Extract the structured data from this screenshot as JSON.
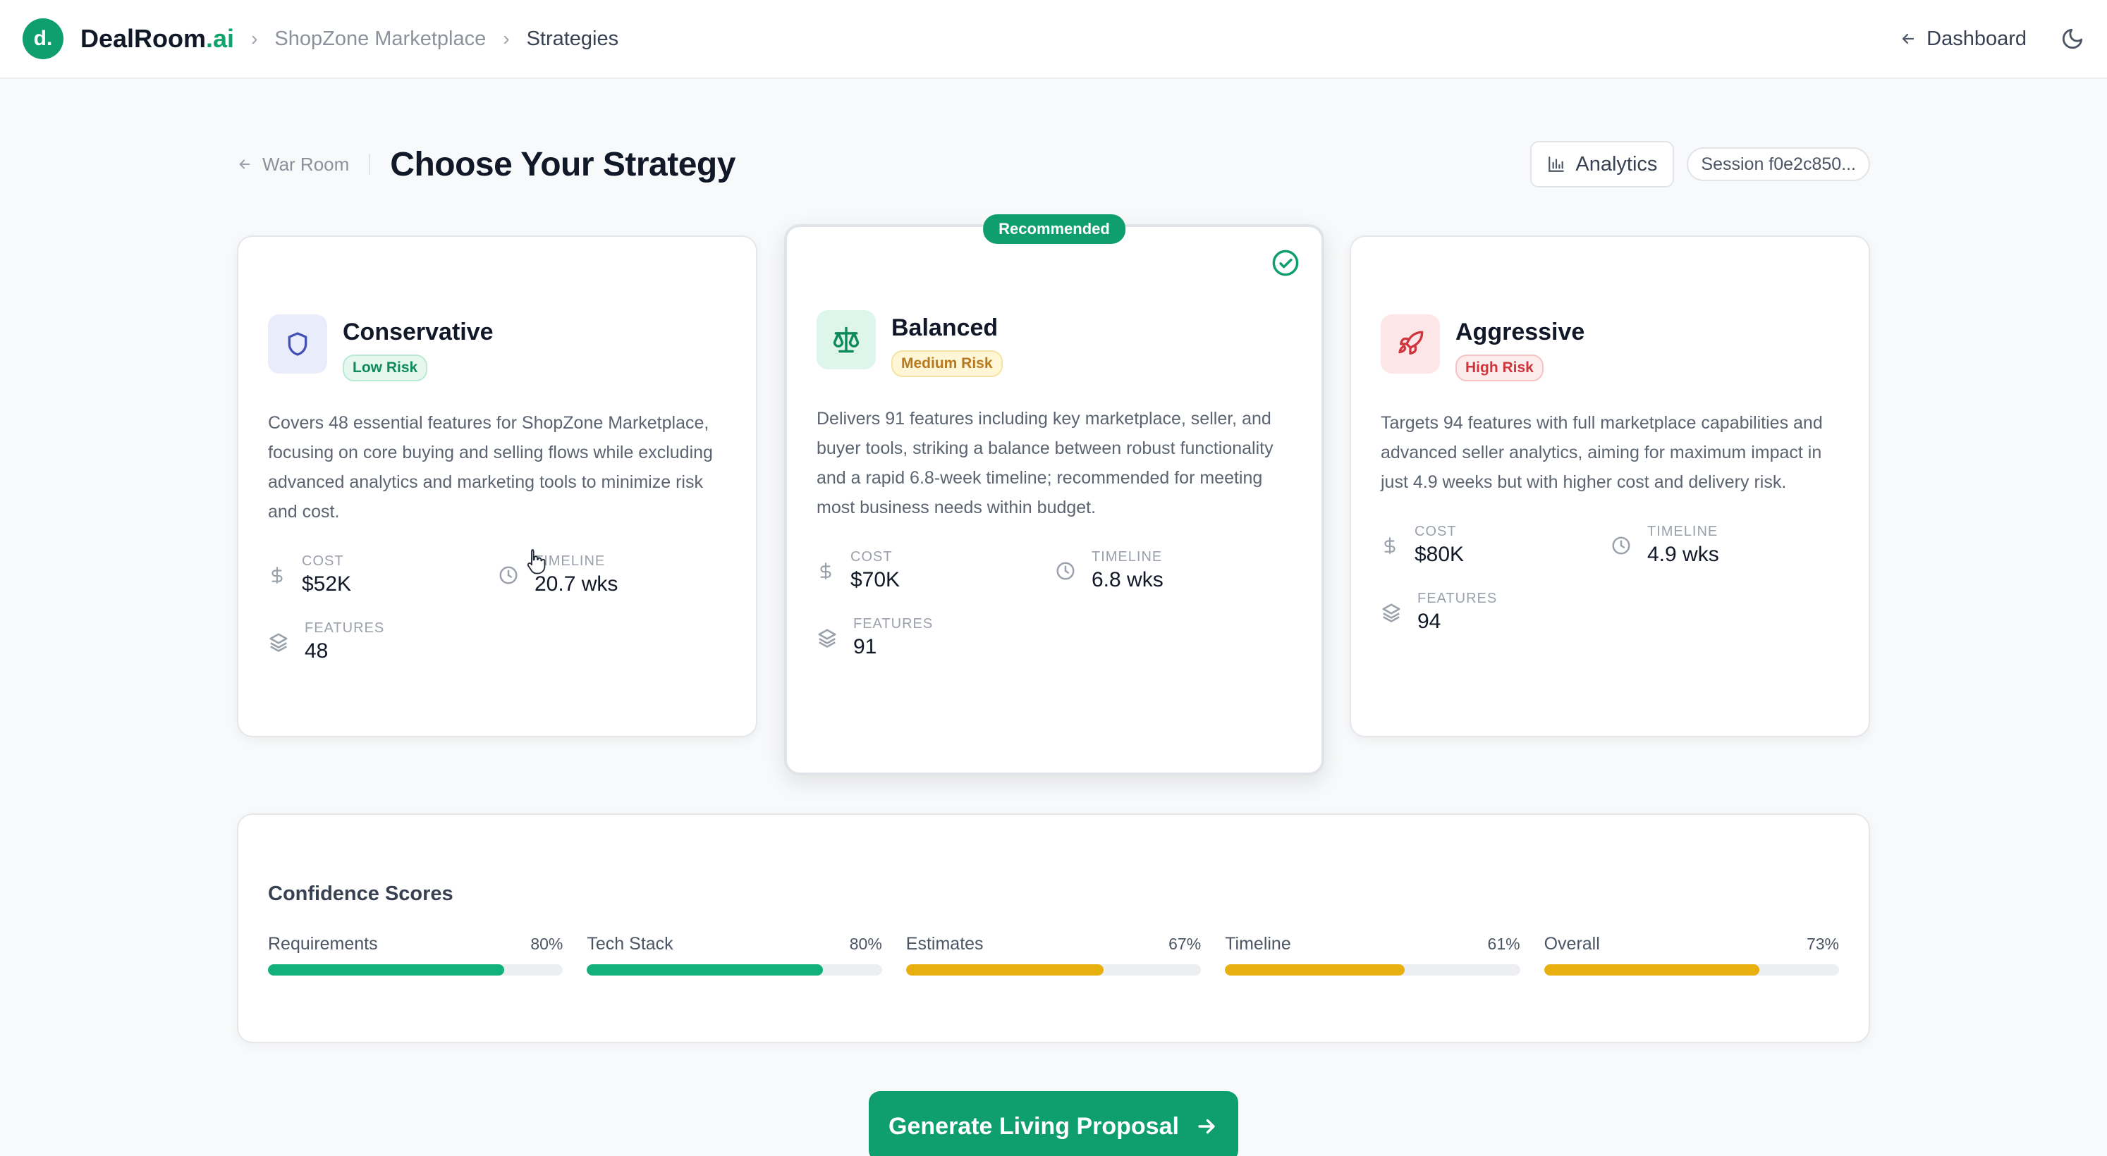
{
  "header": {
    "logo_letter": "d.",
    "brand_main": "DealRoom",
    "brand_suffix": ".ai",
    "breadcrumb": [
      "ShopZone Marketplace",
      "Strategies"
    ],
    "dashboard_label": "Dashboard"
  },
  "page": {
    "back_label": "War Room",
    "title": "Choose Your Strategy",
    "analytics_label": "Analytics",
    "session_label": "Session f0e2c850..."
  },
  "strategies": [
    {
      "name": "Conservative",
      "risk": "Low Risk",
      "description": "Covers 48 essential features for ShopZone Marketplace, focusing on core buying and selling flows while excluding advanced analytics and marketing tools to minimize risk and cost.",
      "cost_label": "COST",
      "cost": "$52K",
      "timeline_label": "TIMELINE",
      "timeline": "20.7 wks",
      "features_label": "FEATURES",
      "features": "48"
    },
    {
      "name": "Balanced",
      "risk": "Medium Risk",
      "recommended_label": "Recommended",
      "description": "Delivers 91 features including key marketplace, seller, and buyer tools, striking a balance between robust functionality and a rapid 6.8-week timeline; recommended for meeting most business needs within budget.",
      "cost_label": "COST",
      "cost": "$70K",
      "timeline_label": "TIMELINE",
      "timeline": "6.8 wks",
      "features_label": "FEATURES",
      "features": "91"
    },
    {
      "name": "Aggressive",
      "risk": "High Risk",
      "description": "Targets 94 features with full marketplace capabilities and advanced seller analytics, aiming for maximum impact in just 4.9 weeks but with higher cost and delivery risk.",
      "cost_label": "COST",
      "cost": "$80K",
      "timeline_label": "TIMELINE",
      "timeline": "4.9 wks",
      "features_label": "FEATURES",
      "features": "94"
    }
  ],
  "confidence": {
    "title": "Confidence Scores",
    "scores": [
      {
        "label": "Requirements",
        "pct": "80%",
        "value": 0.8,
        "color": "#12b07a"
      },
      {
        "label": "Tech Stack",
        "pct": "80%",
        "value": 0.8,
        "color": "#12b07a"
      },
      {
        "label": "Estimates",
        "pct": "67%",
        "value": 0.67,
        "color": "#e8b00f"
      },
      {
        "label": "Timeline",
        "pct": "61%",
        "value": 0.61,
        "color": "#e8b00f"
      },
      {
        "label": "Overall",
        "pct": "73%",
        "value": 0.73,
        "color": "#e8b00f"
      }
    ]
  },
  "cta": {
    "label": "Generate Living Proposal"
  },
  "colors": {
    "brand": "#0f9f6e",
    "low_risk_bg": "#e6f7ef",
    "low_risk_text": "#0f8a5f",
    "medium_risk_bg": "#fff6d6",
    "medium_risk_text": "#b7791f",
    "high_risk_bg": "#fdecec",
    "high_risk_text": "#d0353c"
  }
}
